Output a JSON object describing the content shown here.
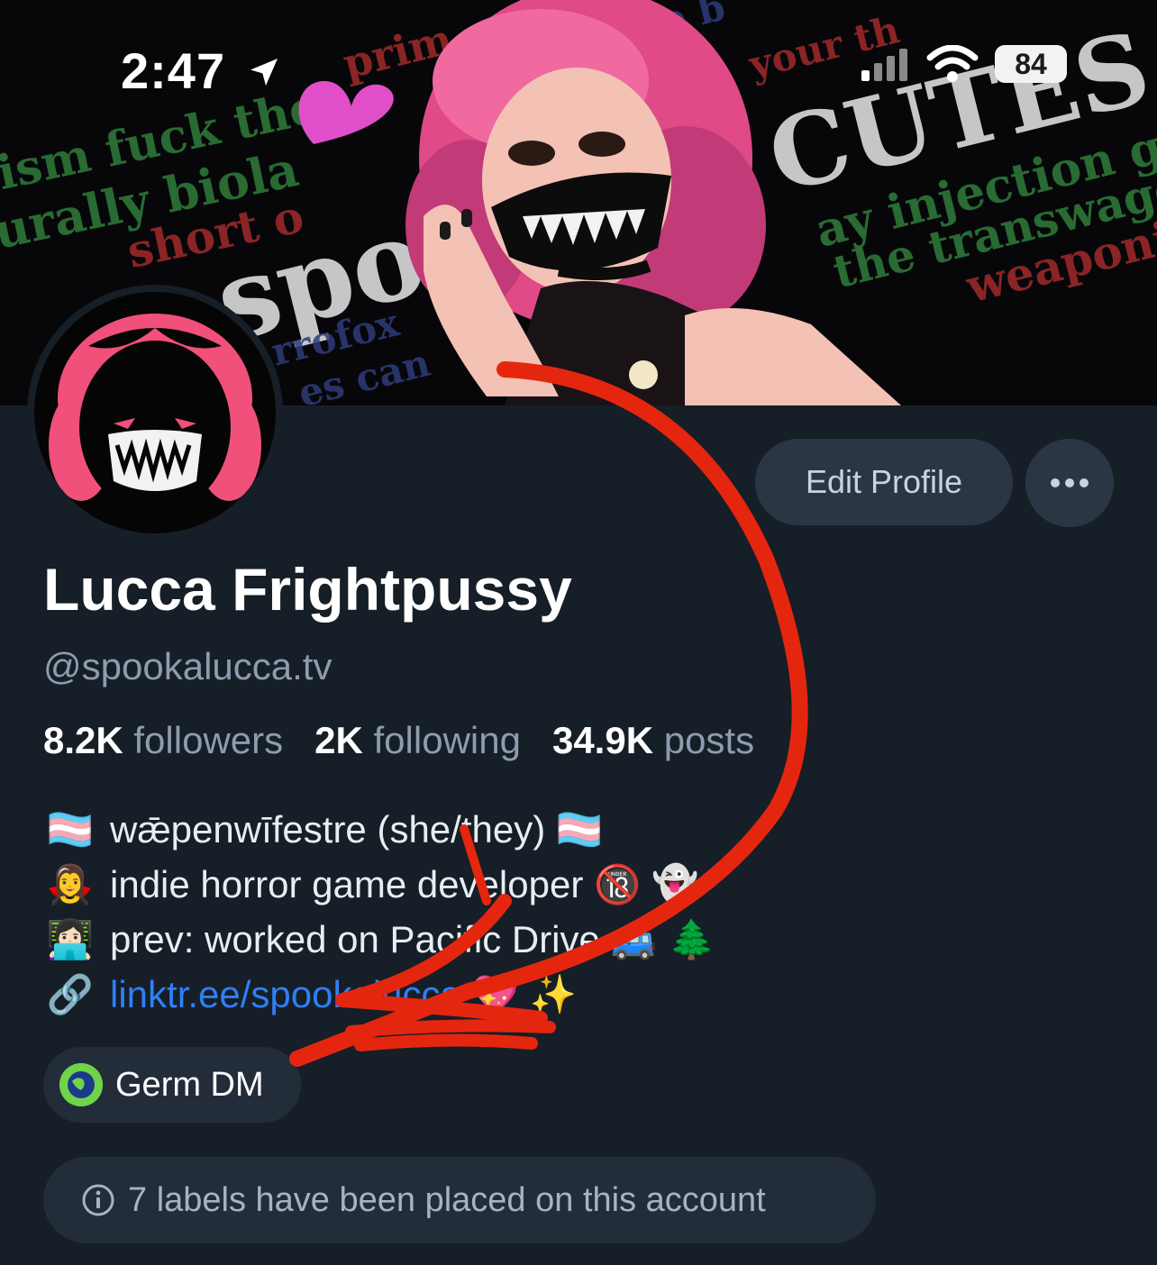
{
  "status_bar": {
    "time": "2:47",
    "battery": "84",
    "icons": [
      "location-arrow-icon",
      "signal-icon",
      "wifi-icon",
      "battery-icon"
    ]
  },
  "banner": {
    "words": [
      "ism fuck the",
      "prim",
      "urally biola",
      "short o",
      "me b",
      "your th",
      "CUTES",
      "ay injection ga",
      "the transwago",
      "weaponiz",
      "spo",
      "rrofox",
      "es can"
    ]
  },
  "profile": {
    "name": "Lucca Frightpussy",
    "handle": "@spookalucca.tv",
    "edit_label": "Edit Profile",
    "more_label": "•••",
    "stats": {
      "followers_count": "8.2K",
      "followers_label": "followers",
      "following_count": "2K",
      "following_label": "following",
      "posts_count": "34.9K",
      "posts_label": "posts"
    },
    "bio": [
      {
        "icon": "🏳️‍⚧️",
        "text": "wǣpenwīfestre (she/they)",
        "trail": "🏳️‍⚧️"
      },
      {
        "icon": "🧛‍♀️",
        "text": "indie horror game developer",
        "trail": "🔞 👻"
      },
      {
        "icon": "👩🏻‍💻",
        "text": "prev: worked on Pacific Drive",
        "trail": "🚙 🌲"
      },
      {
        "icon": "🔗",
        "link": "linktr.ee/spookalucca",
        "trail": "💖 ✨"
      }
    ],
    "germ_label": "Germ DM",
    "labels_notice": "7 labels have been placed on this account"
  },
  "colors": {
    "background": "#161e27",
    "button": "#2b3645",
    "muted_text": "#8d9cae",
    "link": "#2f7ff5",
    "annotation_arrow": "#e5260f",
    "avatar_pink": "#f0507a"
  }
}
